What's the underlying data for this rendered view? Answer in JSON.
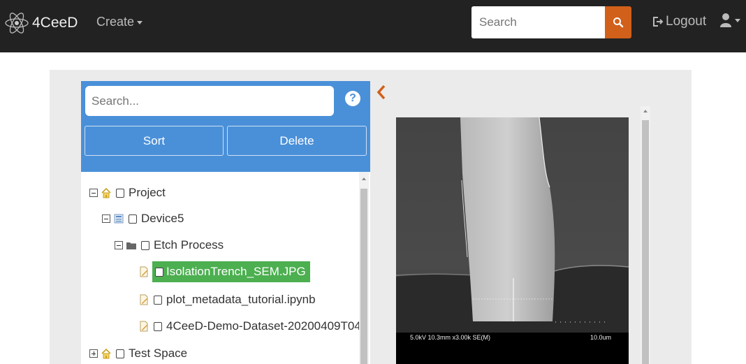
{
  "navbar": {
    "brand": "4CeeD",
    "create_label": "Create",
    "search_placeholder": "Search",
    "logout_label": "Logout"
  },
  "sidebar": {
    "search_placeholder": "Search...",
    "help_label": "?",
    "sort_label": "Sort",
    "delete_label": "Delete"
  },
  "tree": {
    "nodes": [
      {
        "label": "Project",
        "type": "space",
        "expanded": true
      },
      {
        "label": "Device5",
        "type": "collection",
        "expanded": true
      },
      {
        "label": "Etch Process",
        "type": "folder",
        "expanded": true
      },
      {
        "label": "IsolationTrench_SEM.JPG",
        "type": "file",
        "selected": true
      },
      {
        "label": "plot_metadata_tutorial.ipynb",
        "type": "file"
      },
      {
        "label": "4CeeD-Demo-Dataset-20200409T04",
        "type": "file"
      },
      {
        "label": "Test Space",
        "type": "space",
        "expanded": false
      }
    ]
  },
  "viewer": {
    "image_info": "5.0kV 10.3mm x3.00k SE(M)",
    "scale_label": "10.0um"
  },
  "colors": {
    "navbar_bg": "#222222",
    "accent_orange": "#d1601a",
    "panel_blue": "#4a90d9",
    "selected_green": "#4caf50"
  }
}
